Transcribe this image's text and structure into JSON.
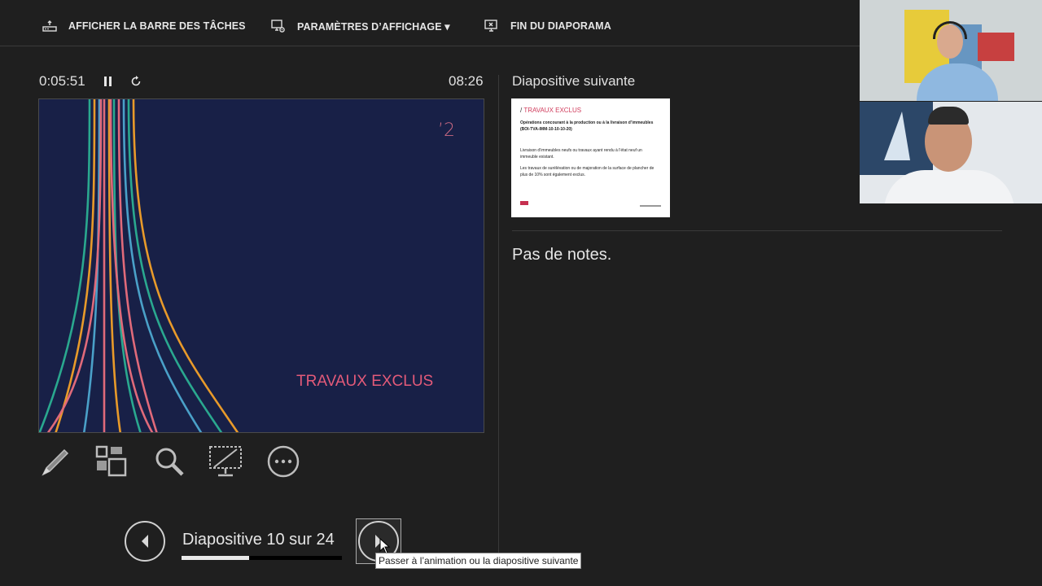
{
  "toolbar": {
    "taskbar_label": "AFFICHER LA BARRE DES TÂCHES",
    "display_settings_label": "PARAMÈTRES D’AFFICHAGE ▾",
    "end_show_label": "FIN DU DIAPORAMA"
  },
  "timer": {
    "elapsed": "0:05:51",
    "clock": "08:26"
  },
  "current_slide": {
    "title": "TRAVAUX EXCLUS",
    "number_mark": "’2"
  },
  "next_slide": {
    "label": "Diapositive suivante",
    "thumb_title": "TRAVAUX EXCLUS",
    "thumb_heading": "Opérations concourant à la production ou à la livraison d’immeubles (BOI-TVA-IMM-10-10-10-20)",
    "thumb_para1": "Livraison d’immeubles neufs ou travaux ayant rendu à l’état neuf un immeuble existant.",
    "thumb_para2": "Les travaux de surélévation ou de majoration de la surface de plancher de plus de 10% sont également exclus."
  },
  "notes": {
    "text": "Pas de notes."
  },
  "navigation": {
    "counter": "Diapositive 10 sur 24",
    "progress": 0.42,
    "tooltip": "Passer à l’animation ou la diapositive suivante"
  },
  "icons": {
    "taskbar": "taskbar-icon",
    "display_settings": "monitor-gear-icon",
    "end_show": "monitor-close-icon",
    "pause": "pause-icon",
    "restart": "restart-icon",
    "pen": "pen-icon",
    "slides": "slides-grid-icon",
    "zoom": "magnifier-icon",
    "black_screen": "black-screen-icon",
    "more": "more-options-icon",
    "prev": "chevron-left-icon",
    "next": "chevron-right-icon"
  },
  "colors": {
    "background": "#1f1f1f",
    "slide_bg": "#182047",
    "accent": "#e35a79"
  }
}
